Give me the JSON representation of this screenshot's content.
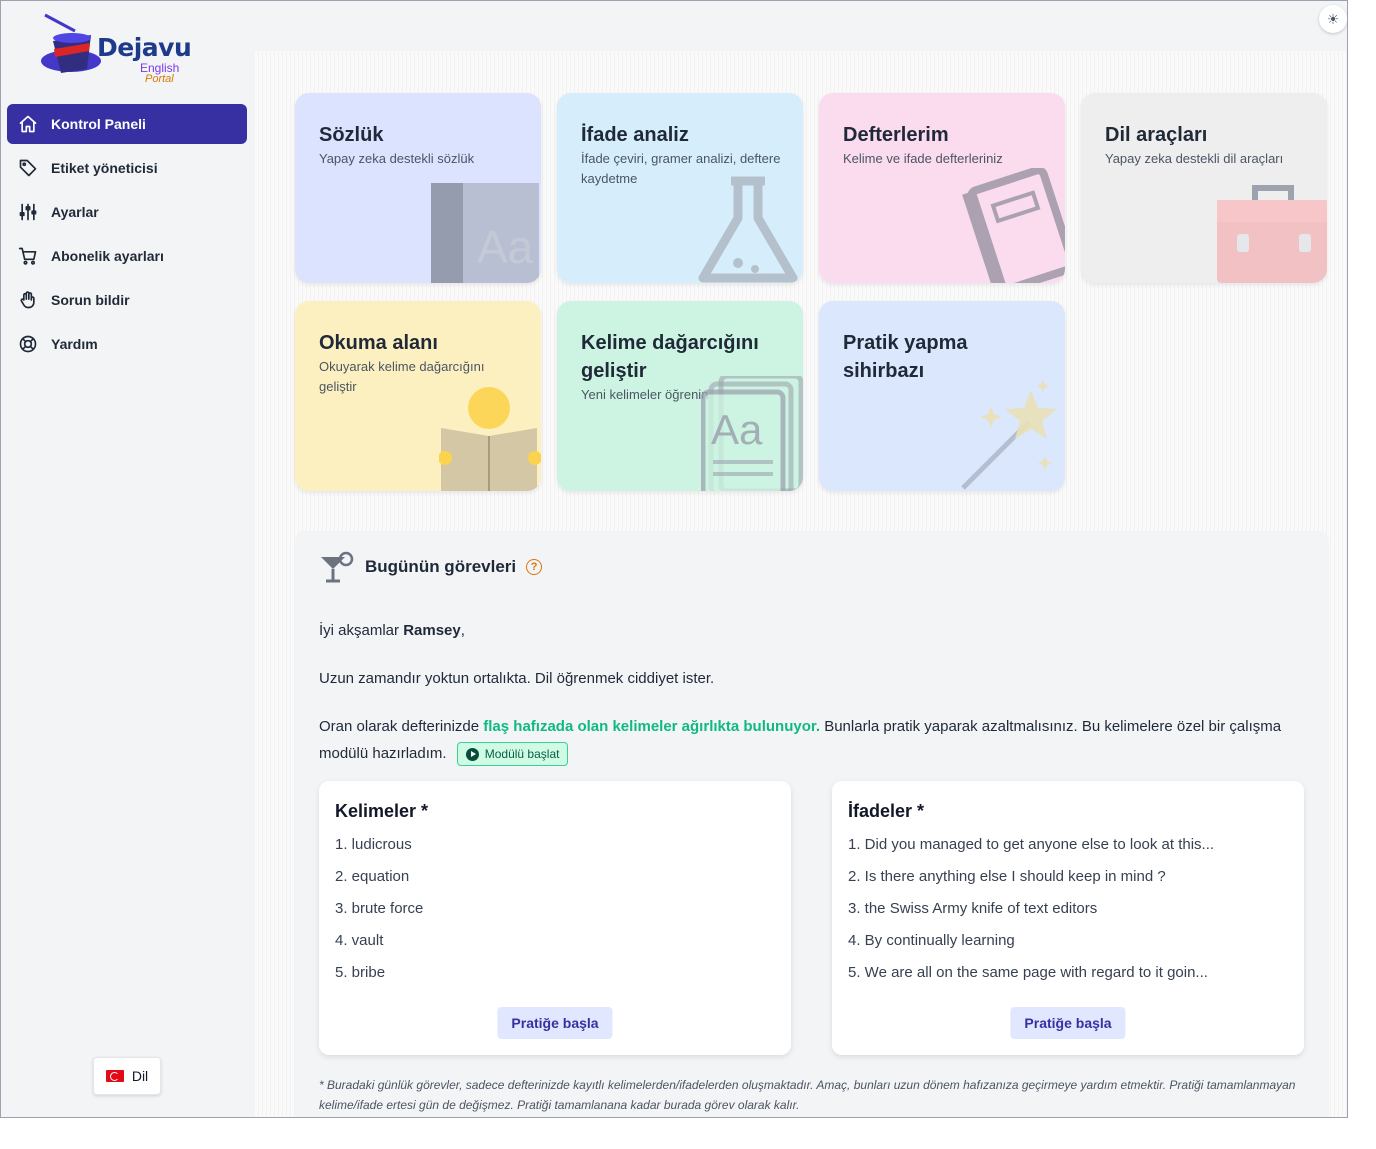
{
  "brand": {
    "name": "Dejavu",
    "sub1": "English",
    "sub2": "Portal"
  },
  "nav": [
    {
      "label": "Kontrol Paneli",
      "icon": "home-icon",
      "active": true
    },
    {
      "label": "Etiket yöneticisi",
      "icon": "tag-icon"
    },
    {
      "label": "Ayarlar",
      "icon": "sliders-icon"
    },
    {
      "label": "Abonelik ayarları",
      "icon": "cart-icon"
    },
    {
      "label": "Sorun bildir",
      "icon": "hand-icon"
    },
    {
      "label": "Yardım",
      "icon": "lifebuoy-icon"
    }
  ],
  "language_button": "Dil",
  "cards": [
    {
      "title": "Sözlük",
      "desc": "Yapay zeka destekli sözlük",
      "bg": "#dbe3ff",
      "icon": "book-icon"
    },
    {
      "title": "İfade analiz",
      "desc": "İfade çeviri, gramer analizi, deftere kaydetme",
      "bg": "#d6eefb",
      "icon": "flask-icon"
    },
    {
      "title": "Defterlerim",
      "desc": "Kelime ve ifade defterleriniz",
      "bg": "#fbdcef",
      "icon": "notebook-icon"
    },
    {
      "title": "Dil araçları",
      "desc": "Yapay zeka destekli dil araçları",
      "bg": "#eeeeef",
      "icon": "toolbox-icon"
    },
    {
      "title": "Okuma alanı",
      "desc": "Okuyarak kelime dağarcığını geliştir",
      "bg": "#fdf0c0",
      "icon": "reader-icon"
    },
    {
      "title": "Kelime dağarcığını geliştir",
      "desc": "Yeni kelimeler öğrenin",
      "bg": "#cdf4e2",
      "icon": "flashcards-icon"
    },
    {
      "title": "Pratik yapma sihirbazı",
      "desc": "",
      "bg": "#dbe7fd",
      "icon": "magic-wand-icon"
    }
  ],
  "tasks": {
    "title": "Bugünün görevleri",
    "help_icon": "?",
    "greeting_prefix": "İyi akşamlar ",
    "user_name": "Ramsey",
    "greeting_suffix": ",",
    "line2": "Uzun zamandır yoktun ortalıkta. Dil öğrenmek ciddiyet ister.",
    "line3_prefix": "Oran olarak defterinizde ",
    "line3_highlight": "flaş hafızada olan kelimeler ağırlıkta bulunuyor.",
    "line3_suffix": " Bunlarla pratik yaparak azaltmalısınız. Bu kelimelere özel bir çalışma modülü hazırladım.",
    "module_button": "Modülü başlat",
    "words": {
      "title": "Kelimeler *",
      "items": [
        "1. ludicrous",
        "2. equation",
        "3. brute force",
        "4. vault",
        "5. bribe"
      ],
      "button": "Pratiğe başla"
    },
    "phrases": {
      "title": "İfadeler *",
      "items": [
        "1. Did you managed to get anyone else to look at this...",
        "2. Is there anything else I should keep in mind ?",
        "3. the Swiss Army knife of text editors",
        "4. By continually learning",
        "5. We are all on the same page with regard to it goin..."
      ],
      "button": "Pratiğe başla"
    },
    "note": "* Buradaki günlük görevler, sadece defterinizde kayıtlı kelimelerden/ifadelerden oluşmaktadır. Amaç, bunları uzun dönem hafızanıza geçirmeye yardım etmektir. Pratiği tamamlanmayan kelime/ifade ertesi gün de değişmez. Pratiği tamamlanana kadar burada görev olarak kalır."
  },
  "accent": "#3730a3",
  "highlight_color": "#10b981"
}
